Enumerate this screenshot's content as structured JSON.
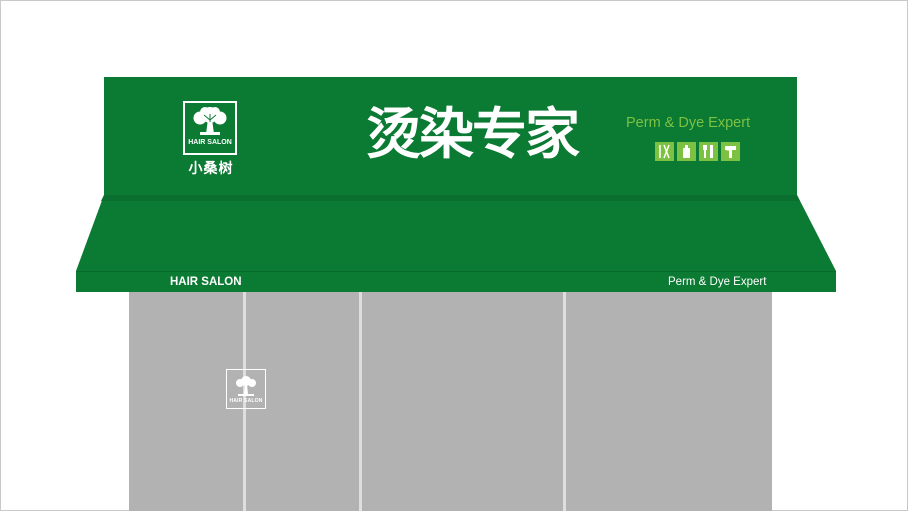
{
  "logo": {
    "badge_text": "HAIR SALON",
    "name": "小桑树"
  },
  "sign": {
    "headline": "烫染专家",
    "subtitle": "Perm & Dye Expert",
    "tool_icons": [
      "scissors-comb-icon",
      "dye-bottle-icon",
      "brush-comb-icon",
      "hair-dryer-icon"
    ]
  },
  "awning": {
    "left_text": "HAIR SALON",
    "right_text": "Perm & Dye Expert"
  },
  "door_logo": {
    "badge_text": "HAIR SALON"
  },
  "colors": {
    "brand_green": "#0b7a33",
    "awning_dark": "#07612a",
    "accent_green": "#7dc142",
    "storefront_grey": "#b2b2b3"
  }
}
